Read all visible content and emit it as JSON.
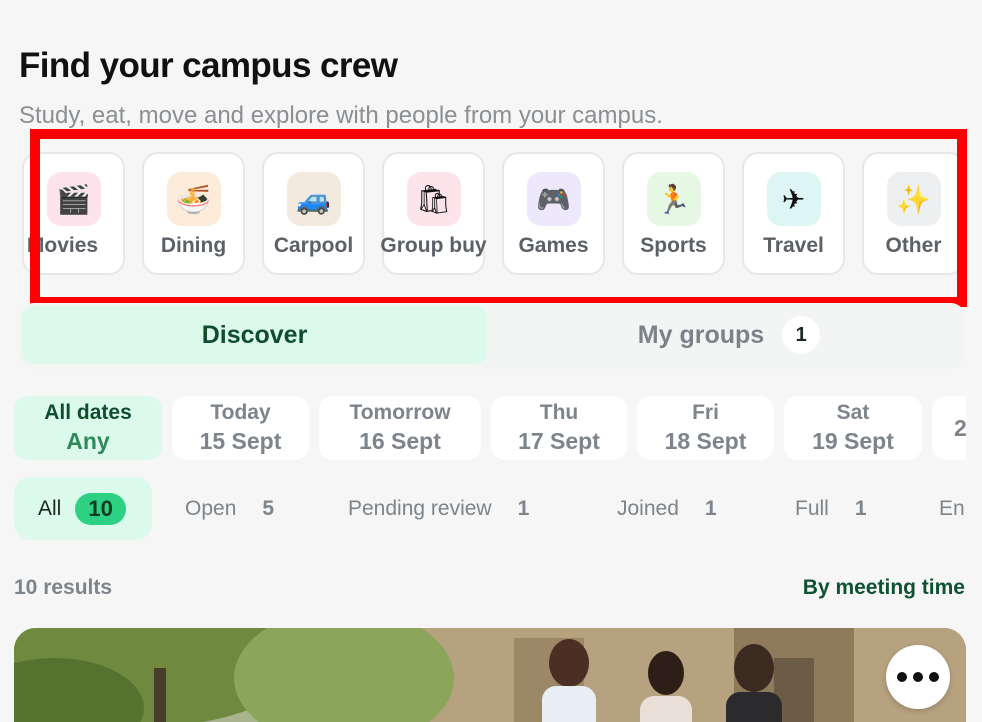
{
  "header": {
    "title": "Find your campus crew",
    "subtitle": "Study, eat, move and explore with people from your campus."
  },
  "categories": [
    {
      "label": "Movies",
      "icon": "clapper-board-icon",
      "glyph": "🎬",
      "bg": "#fde4ec"
    },
    {
      "label": "Dining",
      "icon": "noodle-bowl-icon",
      "glyph": "🍜",
      "bg": "#fdebd9"
    },
    {
      "label": "Carpool",
      "icon": "car-icon",
      "glyph": "🚙",
      "bg": "#f3e9df"
    },
    {
      "label": "Group buy",
      "icon": "shopping-bags-icon",
      "glyph": "🛍",
      "bg": "#fde3ea"
    },
    {
      "label": "Games",
      "icon": "game-controller-icon",
      "glyph": "🎮",
      "bg": "#ede8fb"
    },
    {
      "label": "Sports",
      "icon": "runner-icon",
      "glyph": "🏃",
      "bg": "#e6f7e3"
    },
    {
      "label": "Travel",
      "icon": "airplane-icon",
      "glyph": "✈",
      "bg": "#ddf6f3"
    },
    {
      "label": "Other",
      "icon": "sparkles-icon",
      "glyph": "✨",
      "bg": "#eeeff1"
    }
  ],
  "tabs": {
    "discover": "Discover",
    "my_groups": "My groups",
    "my_groups_count": "1"
  },
  "dates": [
    {
      "top": "All dates",
      "bottom": "Any",
      "active": true
    },
    {
      "top": "Today",
      "bottom": "15 Sept"
    },
    {
      "top": "Tomorrow",
      "bottom": "16 Sept"
    },
    {
      "top": "Thu",
      "bottom": "17 Sept"
    },
    {
      "top": "Fri",
      "bottom": "18 Sept"
    },
    {
      "top": "Sat",
      "bottom": "19 Sept"
    },
    {
      "top": "",
      "bottom": "2"
    }
  ],
  "filters": [
    {
      "label": "All",
      "count": "10",
      "active": true
    },
    {
      "label": "Open",
      "count": "5"
    },
    {
      "label": "Pending review",
      "count": "1"
    },
    {
      "label": "Joined",
      "count": "1"
    },
    {
      "label": "Full",
      "count": "1"
    },
    {
      "label": "En",
      "count": ""
    }
  ],
  "results_label": "10 results",
  "sort_label": "By meeting time",
  "colors": {
    "accent": "#2ed184",
    "accent_soft": "#dcfaeb",
    "accent_dark": "#0f4d2e",
    "highlight": "#ff0000"
  }
}
